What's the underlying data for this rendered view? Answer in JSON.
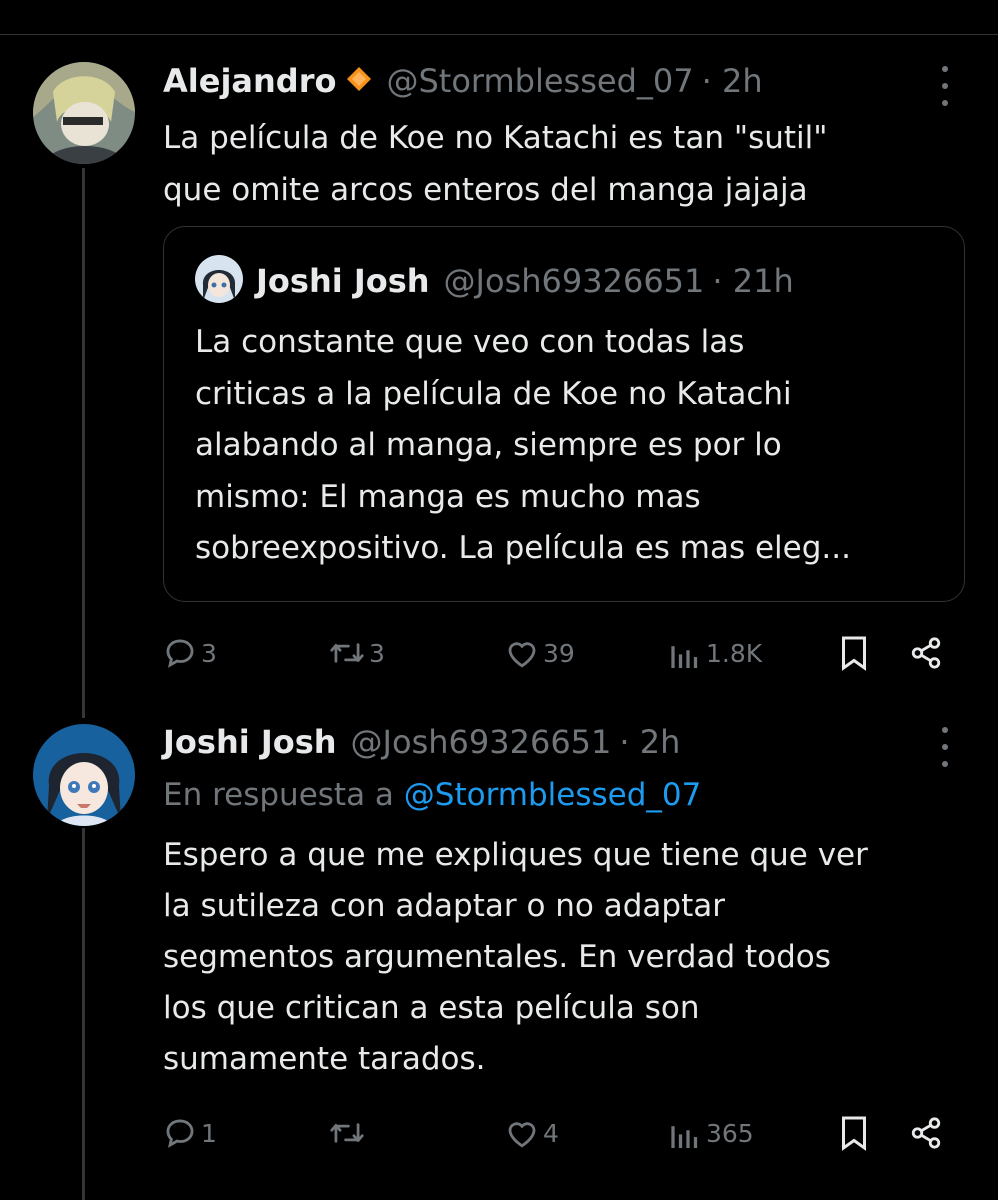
{
  "tweets": [
    {
      "name": "Alejandro",
      "verified_badge": "orange-diamond-icon",
      "handle": "@Stormblessed_07",
      "time": "· 2h",
      "text_lines": [
        "La película de Koe no Katachi es tan \"sutil\"",
        "que omite arcos enteros del manga jajaja"
      ],
      "quote": {
        "name": "Joshi Josh",
        "handle": "@Josh69326651",
        "time": "· 21h",
        "text_lines": [
          "La constante que veo con todas las",
          "criticas a la película de Koe no Katachi",
          "alabando al manga, siempre es por lo",
          "mismo: El manga es mucho mas",
          "sobreexpositivo. La película es mas eleg..."
        ]
      },
      "actions": {
        "replies": "3",
        "reposts": "3",
        "likes": "39",
        "views": "1.8K"
      }
    },
    {
      "name": "Joshi Josh",
      "handle": "@Josh69326651",
      "time": "· 2h",
      "reply_prefix": "En respuesta a",
      "reply_to": "@Stormblessed_07",
      "text_lines": [
        "Espero a que me expliques que tiene que ver",
        "la sutileza con adaptar o no adaptar",
        "segmentos argumentales. En verdad todos",
        "los que critican a esta película son",
        "sumamente tarados."
      ],
      "actions": {
        "replies": "1",
        "reposts": "",
        "likes": "4",
        "views": "365"
      }
    }
  ],
  "colors": {
    "background": "#000000",
    "text": "#e7e9ea",
    "muted": "#71767b",
    "link": "#1d9bf0",
    "badge": "#f7931a"
  }
}
